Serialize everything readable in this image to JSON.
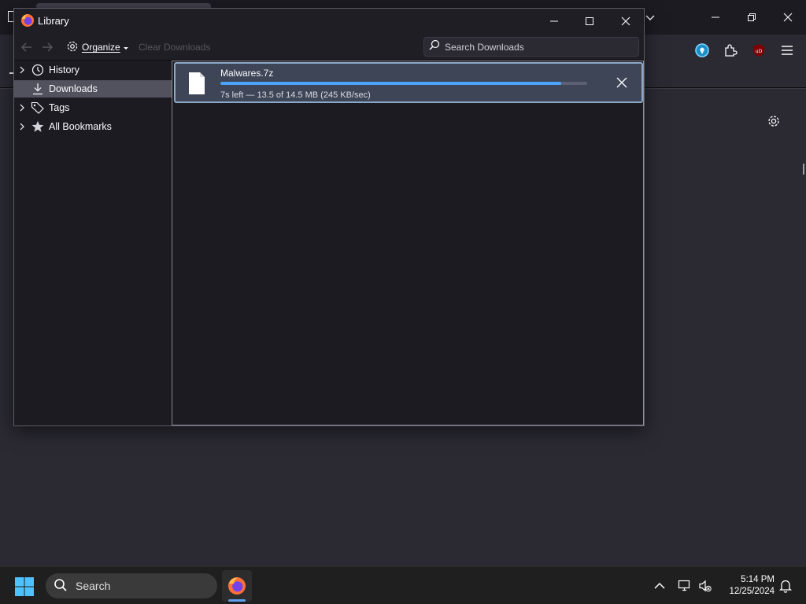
{
  "library": {
    "title": "Library",
    "toolbar": {
      "organize_label": "Organize",
      "clear_downloads_label": "Clear Downloads",
      "search_placeholder": "Search Downloads"
    },
    "sidebar": {
      "items": [
        {
          "label": "History",
          "icon": "clock-icon",
          "expandable": true,
          "selected": false
        },
        {
          "label": "Downloads",
          "icon": "download-icon",
          "expandable": false,
          "selected": true
        },
        {
          "label": "Tags",
          "icon": "tag-icon",
          "expandable": true,
          "selected": false
        },
        {
          "label": "All Bookmarks",
          "icon": "star-icon",
          "expandable": true,
          "selected": false
        }
      ]
    },
    "downloads": [
      {
        "filename": "Malwares.7z",
        "progress_percent": 93,
        "status": "7s left — 13.5 of 14.5 MB (245 KB/sec)"
      }
    ]
  },
  "taskbar": {
    "search_label": "Search",
    "time": "5:14 PM",
    "date": "12/25/2024"
  },
  "colors": {
    "accent": "#4aa3ff",
    "selected_item": "#52525e",
    "download_row": "#3d4556",
    "browser_bg": "#2b2a33"
  }
}
